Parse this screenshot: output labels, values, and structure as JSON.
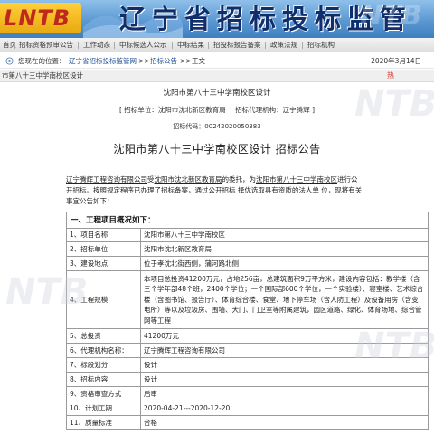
{
  "banner": {
    "logo_text": "LNTB",
    "site_title": "辽宁省招标投标监管网"
  },
  "nav": {
    "items": [
      "首页",
      "招标资格预审公告",
      "工作动态",
      "中标候选人公示",
      "中标结果",
      "招投标报告备案",
      "政策法规",
      "招标机构"
    ]
  },
  "breadcrumb": {
    "prefix": "您现在的位置：",
    "items": [
      "辽宁省招标投标监管网",
      "招标公告",
      "正文"
    ],
    "separator": ">>",
    "date": "2020年3月14日"
  },
  "article_tab": {
    "title": "市第八十三中学南校区设计",
    "hot_label": "热"
  },
  "header": {
    "sub_title": "沈阳市第八十三中学南校区设计",
    "tenderer": "[ 招标单位：沈阳市沈北新区教育局",
    "agency": "招标代理机构：辽宁腾辉 ]",
    "code": "招标代码：00242020050383",
    "main_title": "沈阳市第八十三中学南校区设计 招标公告"
  },
  "intro": {
    "p1_a": "辽宁腾辉工程咨询有限公司",
    "p1_b": "受",
    "p1_c": "沈阳市沈北新区教育局",
    "p1_d": "的委托，为",
    "p1_e": "沈阳市第八十三中学南校区",
    "p1_f": "进行公",
    "p2": "开招标。按照规定程序已办理了招标备案，通过公开招标 择优选取具有资质的法人单 位，现将有关",
    "p3": "事宜公告如下："
  },
  "section": {
    "heading": "一、工程项目概况如下："
  },
  "table": {
    "rows": [
      {
        "k": "1、项目名称",
        "v": "沈阳市第八十三中学南校区"
      },
      {
        "k": "2、招标单位",
        "v": "沈阳市沈北新区教育局"
      },
      {
        "k": "3、建设地点",
        "v": "位于孝沈北街西侧，蒲河路北侧"
      },
      {
        "k": "4、工程规模",
        "v": "本项目总投资41200万元，占地256亩，总建筑面积9万平方米，建设内容包括：教学楼（含三个学年部48个班，2400个学位；一个国际部600个学位，一个实验楼）、寝室楼、艺术综合楼（含图书馆、报告厅）、体育综合楼、食堂、地下停车场（含人防工程）及设备用房（含变电所）等以及垃圾房、围墙、大门、门卫室等附属建筑，园区道路、绿化、体育场地、综合管网等工程"
      },
      {
        "k": "5、总投资",
        "v": "41200万元"
      },
      {
        "k": "6、代理机构名称：",
        "v": "辽宁腾辉工程咨询有限公司"
      },
      {
        "k": "7、标段划分",
        "v": "设计"
      },
      {
        "k": "8、招标内容",
        "v": "设计"
      },
      {
        "k": "9、资格审查方式",
        "v": "后审"
      },
      {
        "k": "10、计划工期",
        "v": "2020-04-21---2020-12-20"
      },
      {
        "k": "11、质量标准",
        "v": "合格"
      }
    ]
  },
  "colors": {
    "banner_top": "#8fc0ea",
    "banner_bottom": "#3f7fc0",
    "title_navy": "#0f2e6b",
    "hot_red": "#dd3333",
    "border_gray": "#9a9a9a"
  }
}
